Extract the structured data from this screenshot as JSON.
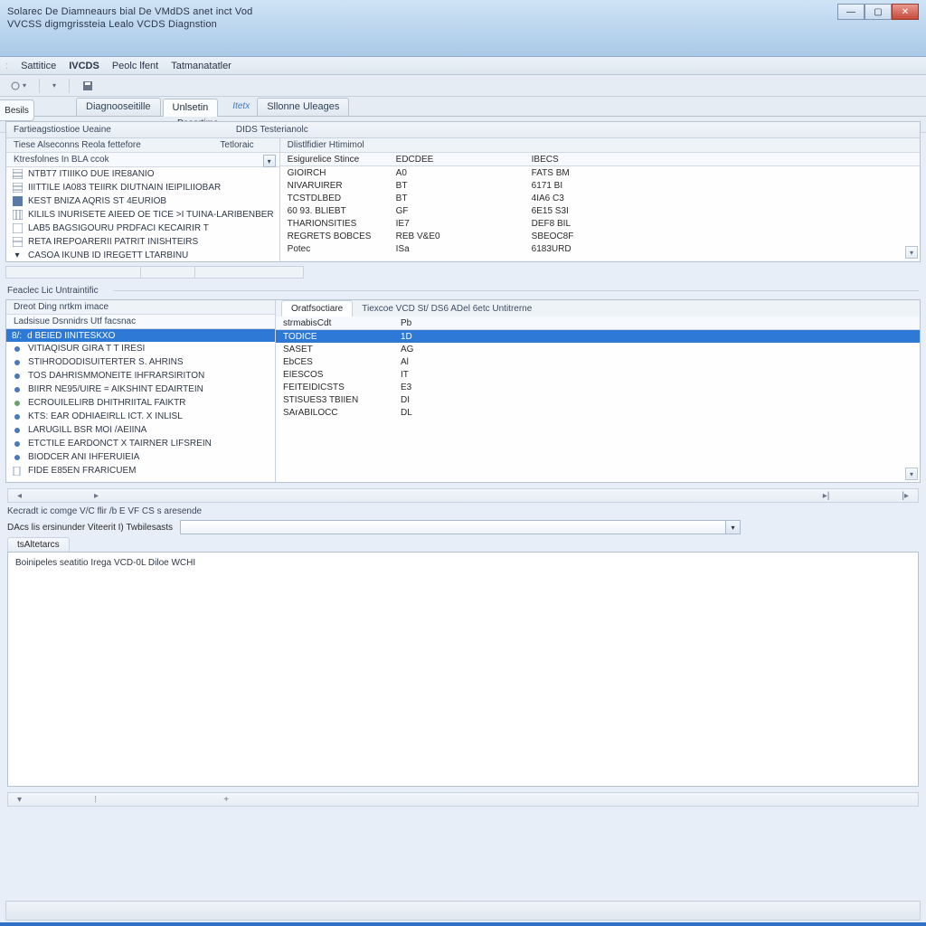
{
  "window": {
    "title1": "Solarec De Diamneaurs bial De VMdDS anet inct Vod",
    "title2": "VVCSS digmgrissteia Lealo VCDS Diagnstion"
  },
  "menu": {
    "items": [
      "Sattitice",
      "IVCDS",
      "Peolc lfent",
      "Tatmanatatler"
    ]
  },
  "doctabs": {
    "items": [
      {
        "label": "Diagnooseitille",
        "active": false
      },
      {
        "label": "Unlsetin",
        "active": true
      },
      {
        "label": "Sllonne Uleages",
        "active": false
      }
    ],
    "side_small": "Itetx",
    "subrow": "Dsoortime"
  },
  "leftbar": {
    "label": "Besils"
  },
  "panel1": {
    "hdr_left": "Fartieagstiostioe Ueaine",
    "hdr_right": "DIDS Testerianolc",
    "left": {
      "hdr_a": "Tiese Alseconns Reola fettefore",
      "hdr_b": "Tetloraic",
      "sub": "Ktresfolnes In BLA ccok",
      "items": [
        "NTBT7 ITIIIKO DUE IRE8ANIO",
        "IIITTILE IA083 TEIIRK DIUTNAIN IEIPILIIOBAR",
        "KEST BNIZA AQRIS ST 4EURIOB",
        "KILILS INURISETE AIEED OE TICE >I TUINA-LARIBENBER",
        "LAB5 BAGSIGOURU PRDFACI KECAIRIR T",
        "RETA IREPOARERII PATRIT INISHTEIRS",
        "CASOA IKUNB ID IREGETT LTARBINU"
      ]
    },
    "right": {
      "hdr_a": "Dlistlfidier Htimimol",
      "cols": [
        "Esigurelice Stince",
        "EDCDEE",
        "IBECS"
      ],
      "rows": [
        [
          "GIOIRCH",
          "A0",
          "FATS BM"
        ],
        [
          "NIVARUIRER",
          "BT",
          "6171 BI"
        ],
        [
          "TCSTDLBED",
          "BT",
          "4IA6 C3"
        ],
        [
          "60 93. BLIEBT",
          "GF",
          "6E15 S3I"
        ],
        [
          "THARIONSITIES",
          "IE7",
          "DEF8 BIL"
        ],
        [
          "REGRETS BOBCES",
          "REB V&E0",
          "SBEOC8F"
        ],
        [
          "Potec",
          "ISa",
          "6183URD"
        ]
      ]
    }
  },
  "section2_title": "Feaclec Lic Untraintific",
  "panel2": {
    "left": {
      "hdr": "Dreot Ding nrtkm imace",
      "sub": "Ladsisue Dsnnidrs Utf facsnac",
      "sel_prefix": "8/:",
      "sel": "d BEIED IINITESKXO",
      "items": [
        "VITIAQISUR GIRA T T IRESI",
        "STIHRODODISUITERTER S. AHRINS",
        "TOS DAHRISMMONEITE IHFRARSIRITON",
        "BIIRR NE95/UIRE = AIKSHINT EDAIRTEIN",
        "ECROUILELIRB DHITHRIITAL FAIKTR",
        "KTS: EAR ODHIAEIRLL ICT. X INLISL",
        "LARUGILL BSR MOI /AEIINA",
        "ETCTILE EARDONCT X TAIRNER LIFSREIN",
        "BIODCER ANI IHFERUIEIA",
        "FIDE E85EN FRARICUEM"
      ]
    },
    "right": {
      "tab_active": "Oratfsoctiare",
      "tab_plain": "Tiexcoe VCD St/ DS6 ADel 6etc Untitrerne",
      "cols": [
        "strmabisCdt",
        "Pb"
      ],
      "sel": [
        "TODICE",
        "1D"
      ],
      "rows": [
        [
          "SASET",
          "AG"
        ],
        [
          "EbCES",
          "Al"
        ],
        [
          "EIESCOS",
          "IT"
        ],
        [
          "FEITEIDICSTS",
          "E3"
        ],
        [
          "STISUES3 TBIIEN",
          "DI"
        ],
        [
          "SArABILOCC",
          "DL"
        ]
      ]
    }
  },
  "status_note": "Kecradt ic comge V/C flir /b E VF CS s aresende",
  "combo": {
    "label": "DAcs lis ersinunder Viteerit I) Twbilesasts"
  },
  "output": {
    "tab": "tsAltetarcs",
    "line": "Boinipeles seatitio Irega VCD-0L Diloe WCHI"
  },
  "icons": {
    "doc": "doc",
    "grid": "grid",
    "db": "db",
    "gear": "gear",
    "disk": "disk"
  }
}
